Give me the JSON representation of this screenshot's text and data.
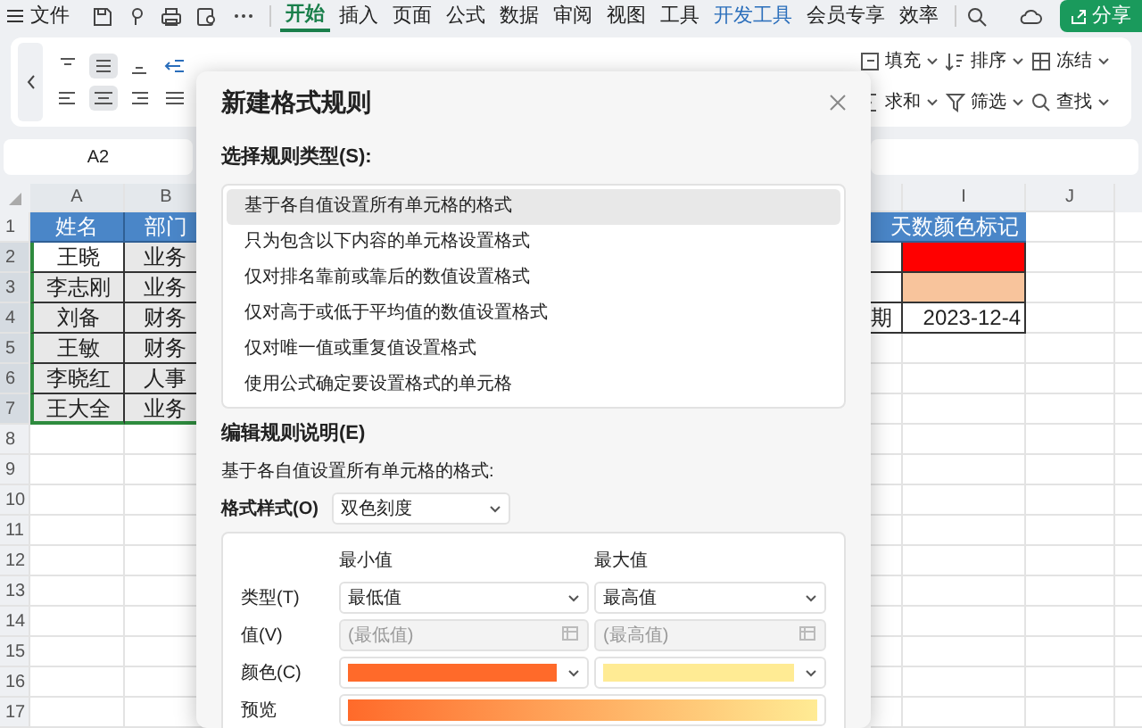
{
  "menu_bar": {
    "file_label": "文件",
    "tabs": [
      {
        "label": "开始",
        "selected": true,
        "kind": "normal"
      },
      {
        "label": "插入",
        "selected": false,
        "kind": "normal"
      },
      {
        "label": "页面",
        "selected": false,
        "kind": "normal"
      },
      {
        "label": "公式",
        "selected": false,
        "kind": "normal"
      },
      {
        "label": "数据",
        "selected": false,
        "kind": "normal"
      },
      {
        "label": "审阅",
        "selected": false,
        "kind": "normal"
      },
      {
        "label": "视图",
        "selected": false,
        "kind": "normal"
      },
      {
        "label": "工具",
        "selected": false,
        "kind": "normal"
      },
      {
        "label": "开发工具",
        "selected": false,
        "kind": "developer"
      },
      {
        "label": "会员专享",
        "selected": false,
        "kind": "normal"
      },
      {
        "label": "效率",
        "selected": false,
        "kind": "normal"
      }
    ],
    "share_button": "分享"
  },
  "ribbon": {
    "align_buttons": [
      {
        "selected": false
      },
      {
        "selected": true
      },
      {
        "selected": false
      },
      {
        "selected": false
      },
      {
        "selected": false
      },
      {
        "selected": true
      },
      {
        "selected": false
      },
      {
        "selected": false
      }
    ],
    "tools": [
      {
        "label": "填充"
      },
      {
        "label": "排序"
      },
      {
        "label": "冻结"
      },
      {
        "label": "求和"
      },
      {
        "label": "筛选"
      },
      {
        "label": "查找"
      }
    ]
  },
  "formula_bar": {
    "cell_ref": "A2"
  },
  "sheet": {
    "columns_left": [
      "A",
      "B"
    ],
    "columns_right": [
      "I",
      "J"
    ],
    "row_numbers": [
      "1",
      "2",
      "3",
      "4",
      "5",
      "6",
      "7",
      "8",
      "9",
      "10",
      "11",
      "12",
      "13",
      "14",
      "15",
      "16",
      "17"
    ],
    "rows_left": [
      {
        "kind": "header",
        "cells": [
          "姓名",
          "部门"
        ],
        "selected": false,
        "active": false
      },
      {
        "kind": "data",
        "cells": [
          "王晓",
          "业务"
        ],
        "selected": true,
        "active": true
      },
      {
        "kind": "data",
        "cells": [
          "李志刚",
          "业务"
        ],
        "selected": true,
        "active": false
      },
      {
        "kind": "data",
        "cells": [
          "刘备",
          "财务"
        ],
        "selected": true,
        "active": false
      },
      {
        "kind": "data",
        "cells": [
          "王敏",
          "财务"
        ],
        "selected": true,
        "active": false
      },
      {
        "kind": "data",
        "cells": [
          "李晓红",
          "人事"
        ],
        "selected": true,
        "active": false
      },
      {
        "kind": "data",
        "cells": [
          "王大全",
          "业务"
        ],
        "selected": true,
        "active": false
      }
    ],
    "rows_right": [
      {
        "kind": "header",
        "text": "天数颜色标记"
      },
      {
        "kind": "fill",
        "color": "#ff0000"
      },
      {
        "kind": "fill",
        "color": "#f8c49c"
      },
      {
        "kind": "value",
        "column_h": "期",
        "column_i": "2023-12-4"
      }
    ]
  },
  "dialog": {
    "title": "新建格式规则",
    "rule_type_label": "选择规则类型(S):",
    "rule_types": [
      {
        "label": "基于各自值设置所有单元格的格式",
        "selected": true
      },
      {
        "label": "只为包含以下内容的单元格设置格式",
        "selected": false
      },
      {
        "label": "仅对排名靠前或靠后的数值设置格式",
        "selected": false
      },
      {
        "label": "仅对高于或低于平均值的数值设置格式",
        "selected": false
      },
      {
        "label": "仅对唯一值或重复值设置格式",
        "selected": false
      },
      {
        "label": "使用公式确定要设置格式的单元格",
        "selected": false
      }
    ],
    "edit_label": "编辑规则说明(E)",
    "description": "基于各自值设置所有单元格的格式:",
    "format_style_label": "格式样式(O)",
    "format_style": "双色刻度",
    "min_header": "最小值",
    "max_header": "最大值",
    "type_label": "类型(T)",
    "min_type": "最低值",
    "max_type": "最高值",
    "value_label": "值(V)",
    "min_value_placeholder": "(最低值)",
    "max_value_placeholder": "(最高值)",
    "color_label": "颜色(C)",
    "color_swatches": [
      {
        "color": "#ff6a2a"
      },
      {
        "color": "#ffeb94"
      }
    ],
    "preview_label": "预览"
  }
}
